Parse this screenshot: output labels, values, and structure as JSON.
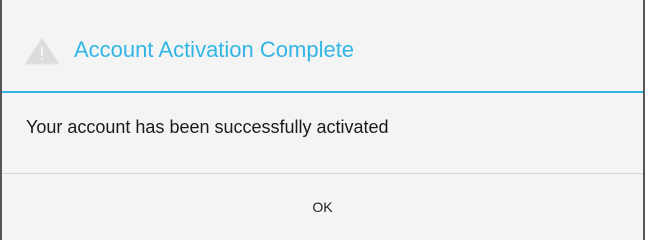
{
  "dialog": {
    "title": "Account Activation Complete",
    "title_icon": "alert-triangle-icon",
    "message": "Your account has been successfully activated",
    "ok_label": "OK"
  },
  "colors": {
    "accent": "#33b5e5",
    "background": "#f4f4f4",
    "text": "#1a1a1a"
  }
}
